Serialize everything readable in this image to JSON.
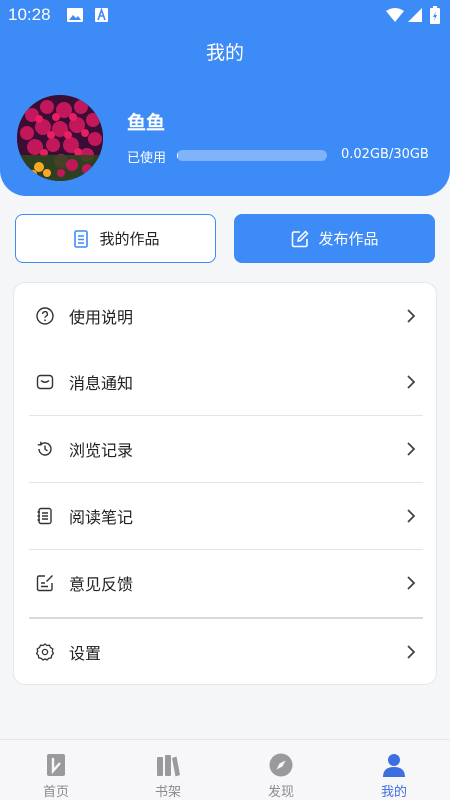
{
  "status_bar": {
    "time": "10:28"
  },
  "page": {
    "title": "我的"
  },
  "profile": {
    "name": "鱼鱼",
    "usage_label": "已使用",
    "usage_value": "0.02GB/30GB",
    "usage_fraction": 0.0007
  },
  "actions": {
    "my_works": "我的作品",
    "publish": "发布作品"
  },
  "menu": [
    {
      "label": "使用说明",
      "icon": "help-circle-icon"
    },
    {
      "label": "消息通知",
      "icon": "message-icon"
    },
    {
      "label": "浏览记录",
      "icon": "history-icon"
    },
    {
      "label": "阅读笔记",
      "icon": "notes-icon"
    },
    {
      "label": "意见反馈",
      "icon": "feedback-icon"
    },
    {
      "label": "设置",
      "icon": "gear-icon"
    }
  ],
  "tabs": [
    {
      "label": "首页",
      "icon": "home-book-icon"
    },
    {
      "label": "书架",
      "icon": "bookshelf-icon"
    },
    {
      "label": "发现",
      "icon": "compass-icon"
    },
    {
      "label": "我的",
      "icon": "person-icon"
    }
  ],
  "colors": {
    "accent": "#3d8bf6",
    "active_tab": "#3d6fe0"
  }
}
